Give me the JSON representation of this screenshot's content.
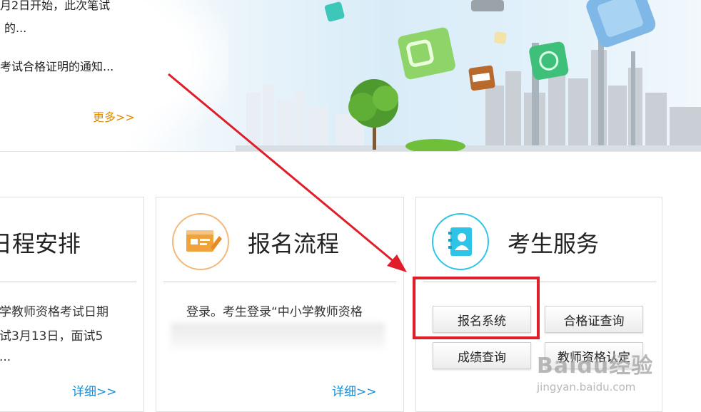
{
  "banner": {
    "news_line1": "月2日开始，此次笔试",
    "news_line2": "的...",
    "news_line3": "考试合格证明的通知...",
    "more_label": "更多>>"
  },
  "cards": {
    "schedule": {
      "title": "日程安排",
      "line1": "学教师资格考试日期",
      "line2": "试3月13日，面试5",
      "line3": "...",
      "detail_label": "详细>>"
    },
    "registration": {
      "title": "报名流程",
      "line1": "登录。考生登录“中小学教师资格",
      "detail_label": "详细>>"
    },
    "services": {
      "title": "考生服务",
      "buttons": [
        "报名系统",
        "合格证查询",
        "成绩查询",
        "教师资格认定"
      ]
    }
  },
  "watermark": {
    "brand": "Baidu经验",
    "url": "jingyan.baidu.com"
  },
  "colors": {
    "accent_orange": "#f0a23c",
    "accent_cyan": "#2ec4e8",
    "link_blue": "#1a8fd6",
    "more_orange": "#e08a00",
    "annotation_red": "#e01e2a"
  }
}
